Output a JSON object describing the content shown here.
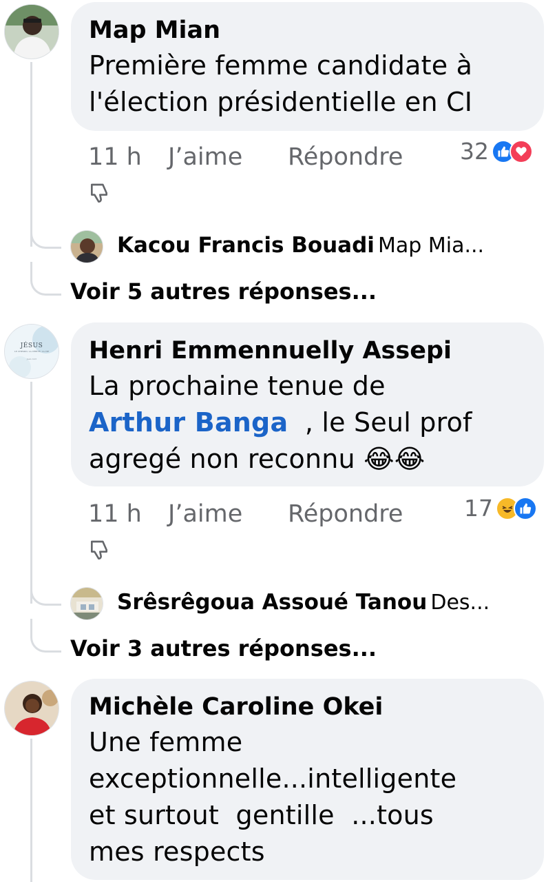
{
  "comments": [
    {
      "author": "Map Mian",
      "lines": [
        "Première femme candidate à",
        "l'élection présidentielle en CI"
      ],
      "time": "11 h",
      "like": "J’aime",
      "reply": "Répondre",
      "reaction_count": "32",
      "reactions": [
        "like-reaction",
        "love-reaction"
      ],
      "reply_preview": {
        "author": "Kacou Francis Bouadi",
        "text": "Map Mia..."
      },
      "more_replies": "Voir 5 autres réponses..."
    },
    {
      "author": "Henri Emmennuelly Assepi",
      "line1": "La prochaine tenue de",
      "mention": "Arthur Banga",
      "line2_rest": ", le Seul prof",
      "line3": "agregé non reconnu 😂😂",
      "avatar_text": {
        "title": "JÉSUS",
        "subtitle": "LE CHEMIN, LA VÉRITÉ, LA VIE",
        "ref": "Jean 14:6"
      },
      "time": "11 h",
      "like": "J’aime",
      "reply": "Répondre",
      "reaction_count": "17",
      "reactions": [
        "haha-reaction",
        "like-reaction"
      ],
      "reply_preview": {
        "author": "Srêsrêgoua Assoué Tanou",
        "text": "Des..."
      },
      "more_replies": "Voir 3 autres réponses..."
    },
    {
      "author": "Michèle Caroline Okei",
      "lines": [
        "Une femme",
        "exceptionnelle...intelligente",
        "et surtout  gentille  ...tous",
        "mes respects"
      ]
    }
  ],
  "colors": {
    "bubble": "#f0f2f5",
    "meta": "#65676b",
    "mention": "#1b64c8",
    "like": "#1877f2",
    "love": "#f33e58",
    "haha": "#f7b928"
  }
}
